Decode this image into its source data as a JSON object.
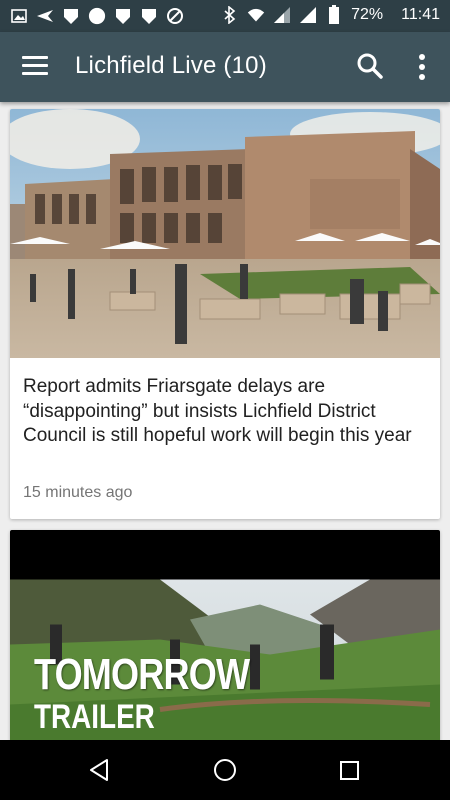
{
  "status_bar": {
    "battery": "72%",
    "time": "11:41",
    "left_icons": [
      "image-icon",
      "send-icon",
      "shield-icon",
      "circle-icon",
      "shield-icon",
      "shield-icon",
      "blocked-icon"
    ],
    "right_icons": [
      "bluetooth-icon",
      "wifi-icon",
      "cell-signal-icon",
      "cell-signal-icon",
      "battery-icon"
    ]
  },
  "app_bar": {
    "title": "Lichfield Live (10)",
    "color": "#3e535c",
    "icons": [
      "menu-icon",
      "search-icon",
      "more-vert-icon"
    ]
  },
  "feed": [
    {
      "headline": "Report admits Friarsgate delays are “disappointing” but insists Lichfield District Council is still hopeful work will begin this year",
      "time": "15 minutes ago",
      "image": "architectural rendering of a plaza with restaurants"
    },
    {
      "overlay_title": "TOMORROW",
      "overlay_sub": "TRAILER",
      "image": "people walking across green hillside"
    }
  ],
  "nav_bar": {
    "icons": [
      "back-icon",
      "home-icon",
      "recents-icon"
    ]
  }
}
